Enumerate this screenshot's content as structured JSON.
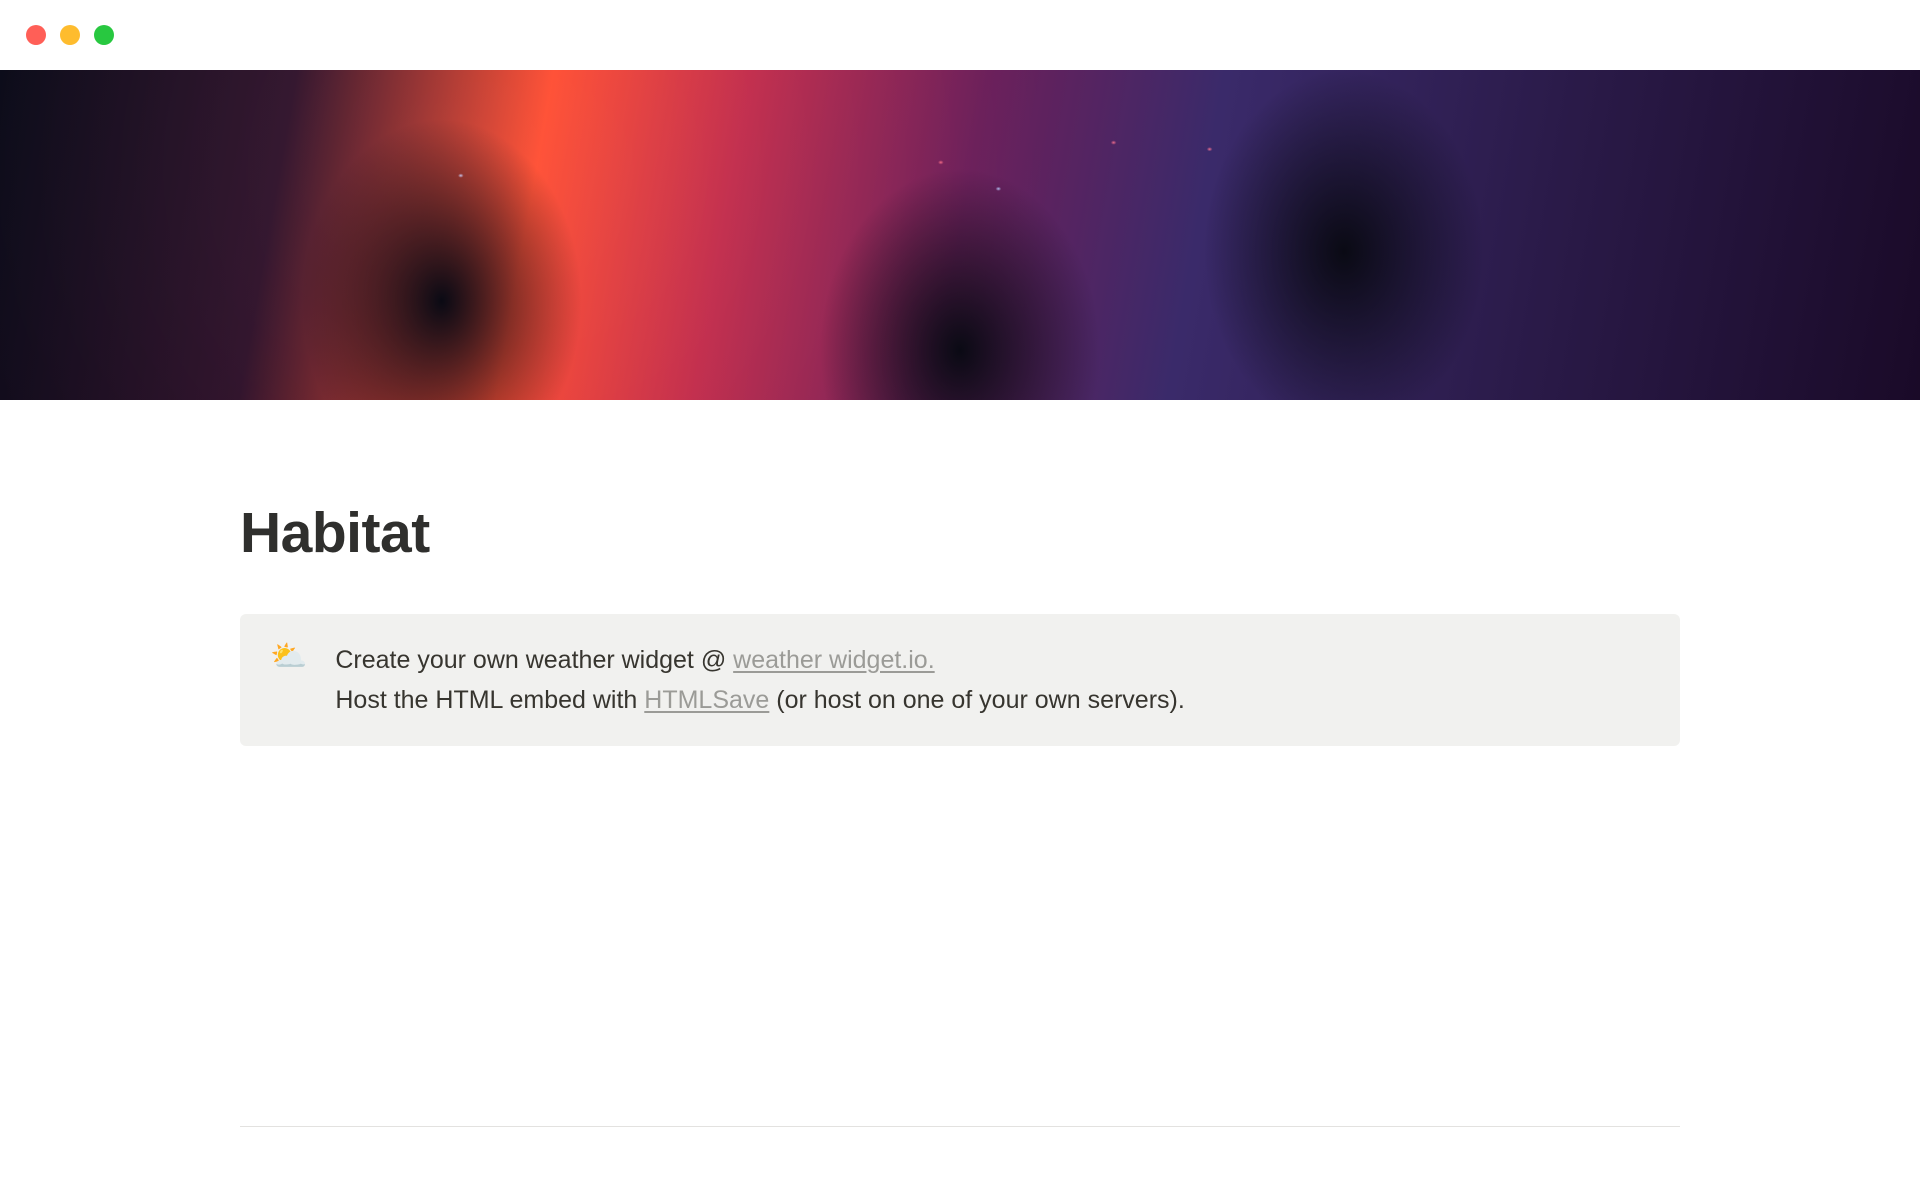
{
  "page": {
    "title": "Habitat"
  },
  "callout": {
    "icon": "⛅",
    "line1_prefix": "Create your own weather widget @ ",
    "link1_text": "weather widget.io.",
    "line2_prefix": "Host the HTML embed with ",
    "link2_text": "HTMLSave",
    "line2_suffix": " (or host on one of your own servers)."
  }
}
